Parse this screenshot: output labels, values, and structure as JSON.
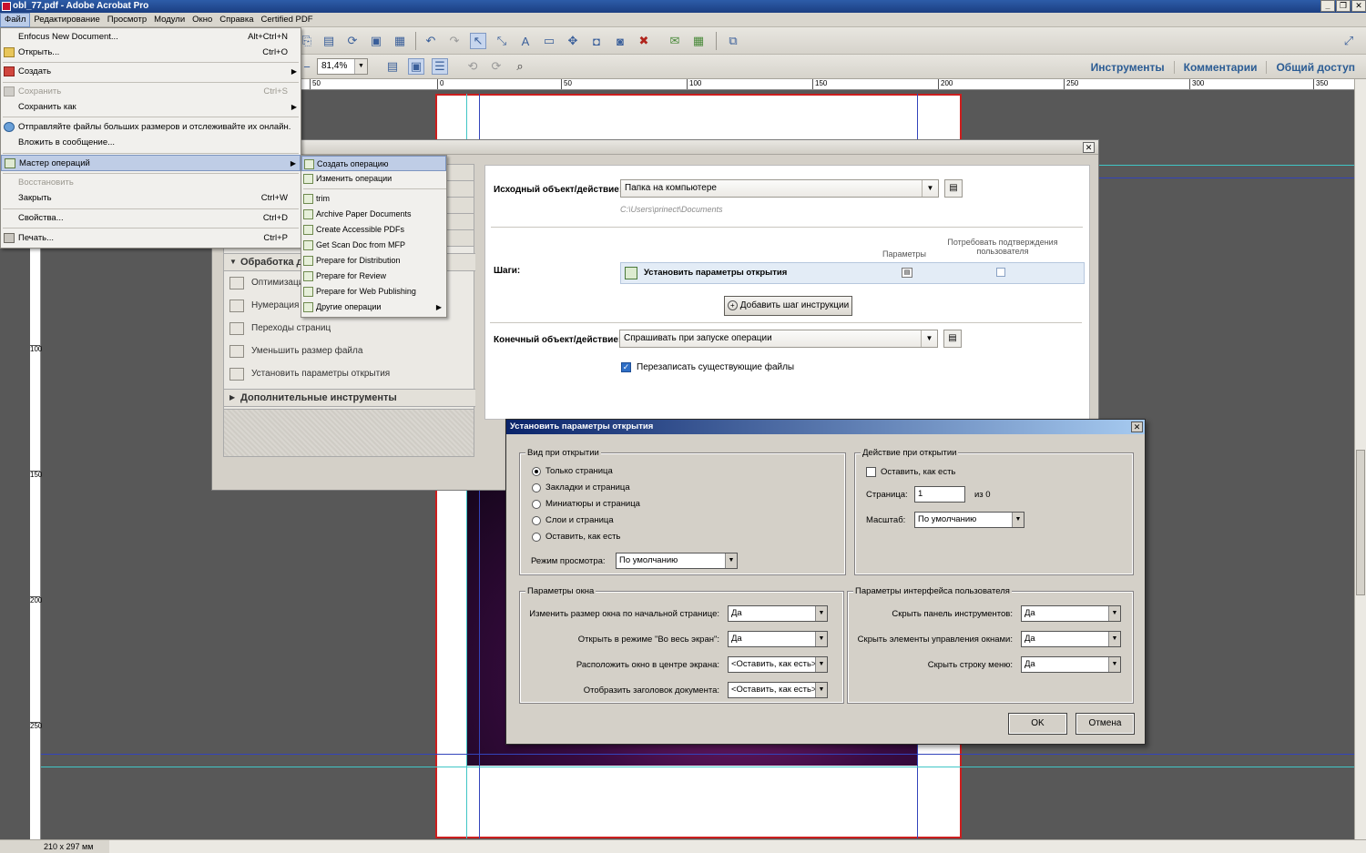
{
  "window": {
    "title": "obl_77.pdf - Adobe Acrobat Pro",
    "buttons": [
      "_",
      "❐",
      "✕"
    ]
  },
  "menubar": [
    "Файл",
    "Редактирование",
    "Просмотр",
    "Модули",
    "Окно",
    "Справка",
    "Certified PDF"
  ],
  "toolbar": {
    "zoom": "81,4%",
    "right_links": [
      "Инструменты",
      "Комментарии",
      "Общий доступ"
    ]
  },
  "ruler": {
    "h_ticks": [
      "50",
      "0",
      "50",
      "100",
      "150",
      "200",
      "250",
      "300",
      "350"
    ],
    "v_ticks": [
      "100",
      "150",
      "200",
      "250"
    ]
  },
  "status": {
    "page_size": "210 x 297 мм"
  },
  "file_menu": {
    "items": [
      {
        "label": "Enfocus New Document...",
        "shortcut": "Alt+Ctrl+N"
      },
      {
        "label": "Открыть...",
        "shortcut": "Ctrl+O"
      },
      {
        "label": "Создать",
        "shortcut": ""
      },
      {
        "label": "Сохранить",
        "shortcut": "Ctrl+S"
      },
      {
        "label": "Сохранить как",
        "shortcut": ""
      },
      {
        "label": "Отправляйте файлы больших размеров и отслеживайте их онлайн.",
        "shortcut": ""
      },
      {
        "label": "Вложить в сообщение...",
        "shortcut": ""
      },
      {
        "label": "Мастер операций",
        "shortcut": ""
      },
      {
        "label": "Восстановить",
        "shortcut": ""
      },
      {
        "label": "Закрыть",
        "shortcut": "Ctrl+W"
      },
      {
        "label": "Свойства...",
        "shortcut": "Ctrl+D"
      },
      {
        "label": "Печать...",
        "shortcut": "Ctrl+P"
      }
    ]
  },
  "submenu": {
    "items": [
      "Создать операцию",
      "Изменить операции",
      "trim",
      "Archive Paper Documents",
      "Create Accessible PDFs",
      "Get Scan Doc from MFP",
      "Prepare for Distribution",
      "Prepare for Review",
      "Prepare for Web Publishing",
      "Другие операции"
    ]
  },
  "action_wizard": {
    "left_panel": {
      "group_title": "Обработка до",
      "items": [
        "Оптимизация",
        "Нумерация ст",
        "Переходы страниц",
        "Уменьшить размер файла",
        "Установить параметры открытия"
      ],
      "more_tools": "Дополнительные инструменты"
    },
    "source_label": "Исходный объект/действие:",
    "source_value": "Папка на компьютере",
    "source_path": "C:\\Users\\prinect\\Documents",
    "steps_label": "Шаги:",
    "col_params": "Параметры",
    "col_confirm": "Потребовать подтверждения пользователя",
    "step_name": "Установить параметры открытия",
    "add_step_btn": "Добавить шаг инструкции",
    "dest_label": "Конечный объект/действие:",
    "dest_value": "Спрашивать при запуске операции",
    "overwrite_label": "Перезаписать существующие файлы"
  },
  "open_dialog": {
    "title": "Установить параметры открытия",
    "view_group": "Вид при открытии",
    "view_options": [
      "Только страница",
      "Закладки и страница",
      "Миниатюры и страница",
      "Слои и страница",
      "Оставить, как есть"
    ],
    "view_selected": 0,
    "mode_label": "Режим просмотра:",
    "mode_value": "По умолчанию",
    "action_group": "Действие при открытии",
    "keep_label": "Оставить, как есть",
    "page_label": "Страница:",
    "page_value": "1",
    "page_of": "из 0",
    "scale_label": "Масштаб:",
    "scale_value": "По умолчанию",
    "window_group": "Параметры окна",
    "window_rows": [
      {
        "label": "Изменить размер окна по начальной странице:",
        "value": "Да"
      },
      {
        "label": "Открыть в режиме \"Во весь экран\":",
        "value": "Да"
      },
      {
        "label": "Расположить окно в центре экрана:",
        "value": "<Оставить, как есть>"
      },
      {
        "label": "Отобразить заголовок документа:",
        "value": "<Оставить, как есть>"
      }
    ],
    "ui_group": "Параметры интерфейса пользователя",
    "ui_rows": [
      {
        "label": "Скрыть панель инструментов:",
        "value": "Да"
      },
      {
        "label": "Скрыть элементы управления окнами:",
        "value": "Да"
      },
      {
        "label": "Скрыть строку меню:",
        "value": "Да"
      }
    ],
    "ok": "OK",
    "cancel": "Отмена"
  },
  "colors": {
    "accent": "#2b5c94",
    "page_border": "#cc1e1e",
    "guide_blue": "#3344bb",
    "guide_cyan": "#40c6c6"
  }
}
